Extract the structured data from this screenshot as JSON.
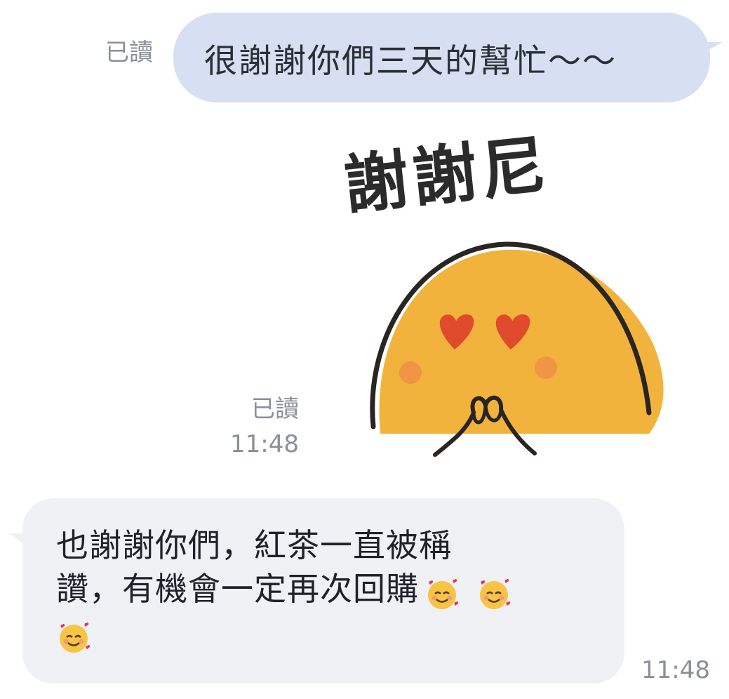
{
  "messages": [
    {
      "direction": "outgoing",
      "status": "已讀",
      "text": "很謝謝你們三天的幫忙～～"
    },
    {
      "direction": "outgoing",
      "type": "sticker",
      "sticker_text": "謝謝尼",
      "status": "已讀",
      "time": "11:48"
    },
    {
      "direction": "incoming",
      "text_line1": "也謝謝你們，紅茶一直被稱",
      "text_line2": "讚，有機會一定再次回購",
      "emoji": "smiling-face-with-hearts-icon",
      "time": "11:48"
    }
  ],
  "colors": {
    "outgoing_bubble": "#d7dff2",
    "incoming_bubble": "#eff1f5",
    "meta_text": "#8a8f99",
    "sticker_face": "#f2b33d"
  }
}
